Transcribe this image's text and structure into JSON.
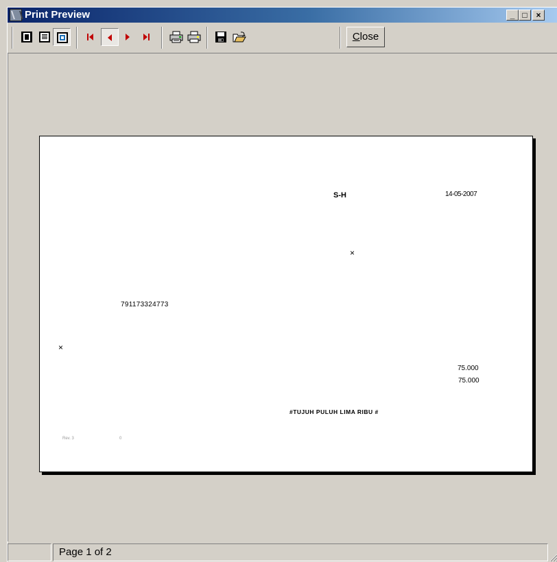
{
  "window": {
    "title": "Print Preview",
    "controls": [
      "_",
      "□",
      "×"
    ]
  },
  "toolbar": {
    "buttons": [
      {
        "name": "single-page-icon"
      },
      {
        "name": "text-page-icon"
      },
      {
        "name": "fit-page-icon",
        "pressed": true
      },
      {
        "name": "first-page-icon"
      },
      {
        "name": "previous-page-icon"
      },
      {
        "name": "next-page-icon"
      },
      {
        "name": "last-page-icon"
      },
      {
        "name": "printer-setup-icon"
      },
      {
        "name": "print-icon"
      },
      {
        "name": "save-icon"
      },
      {
        "name": "open-folder-icon"
      }
    ],
    "close_label_underlined": "C",
    "close_label_rest": "lose"
  },
  "document": {
    "code": "S-H",
    "date": "14-05-2007",
    "mark_center": "×",
    "account_number": "791173324773",
    "mark_left": "×",
    "amount_1": "75.000",
    "amount_2": "75.000",
    "amount_words": "#TUJUH PULUH LIMA RIBU #",
    "footer_left": "Rev. 3",
    "footer_right": "0"
  },
  "status": {
    "page_info": "Page 1 of 2"
  },
  "colors": {
    "titlebar_start": "#0a246a",
    "titlebar_end": "#a6caf0",
    "face": "#d4d0c8",
    "arrow_red": "#c00000"
  }
}
